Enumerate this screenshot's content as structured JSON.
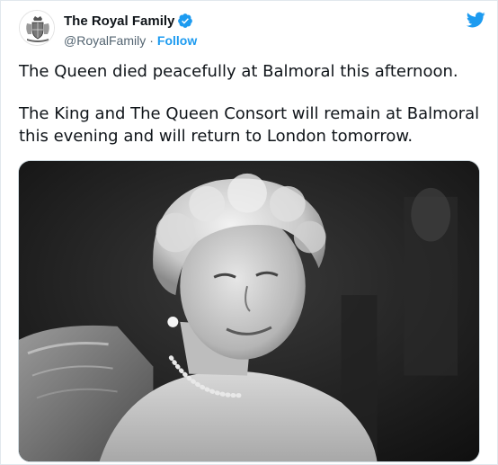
{
  "account": {
    "display_name": "The Royal Family",
    "handle": "@RoyalFamily",
    "separator": "·",
    "follow_label": "Follow",
    "verified": true,
    "verified_color": "#1d9bf0"
  },
  "brand": {
    "icon": "twitter-bird-icon",
    "color": "#1d9bf0"
  },
  "tweet": {
    "paragraph_1": "The Queen died peacefully at Balmoral this afternoon.",
    "paragraph_2": "The King and The Queen Consort will remain at Balmoral this evening and will return to London tomorrow."
  },
  "media": {
    "type": "photo",
    "tone": "black-and-white"
  }
}
